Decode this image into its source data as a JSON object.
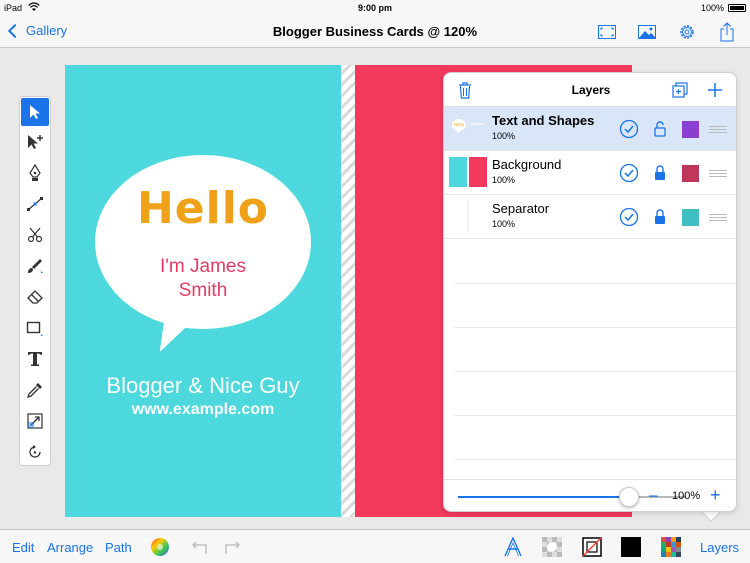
{
  "status_bar": {
    "carrier": "iPad",
    "time": "9:00 pm",
    "battery": "100%"
  },
  "nav": {
    "back_label": "Gallery",
    "title": "Blogger Business Cards @ 120%"
  },
  "card": {
    "hello": "Hello",
    "name_line1": "I'm James",
    "name_line2": "Smith",
    "tagline": "Blogger & Nice Guy",
    "website": "www.example.com",
    "colors": {
      "left": "#4cd8dc",
      "right": "#f3395c",
      "hello": "#f0a11a",
      "name": "#e43a66"
    }
  },
  "toolbox": {
    "tools": [
      "select-tool",
      "subselect-tool",
      "pen-tool",
      "node-tool",
      "scissors-tool",
      "brush-tool",
      "eraser-tool",
      "shape-tool",
      "text-tool",
      "eyedropper-tool",
      "transform-tool",
      "rotate-tool"
    ],
    "selected": "select-tool"
  },
  "layers": {
    "title": "Layers",
    "items": [
      {
        "name": "Text and Shapes",
        "opacity": "100%",
        "color": "#8a3fd0",
        "locked": false,
        "active": true
      },
      {
        "name": "Background",
        "opacity": "100%",
        "color": "#c0375c",
        "locked": true,
        "active": false
      },
      {
        "name": "Separator",
        "opacity": "100%",
        "color": "#3fbfc4",
        "locked": true,
        "active": false
      }
    ],
    "opacity_slider": 0.75,
    "zoom": "100%"
  },
  "bottom_bar": {
    "edit": "Edit",
    "arrange": "Arrange",
    "path": "Path",
    "layers": "Layers"
  }
}
